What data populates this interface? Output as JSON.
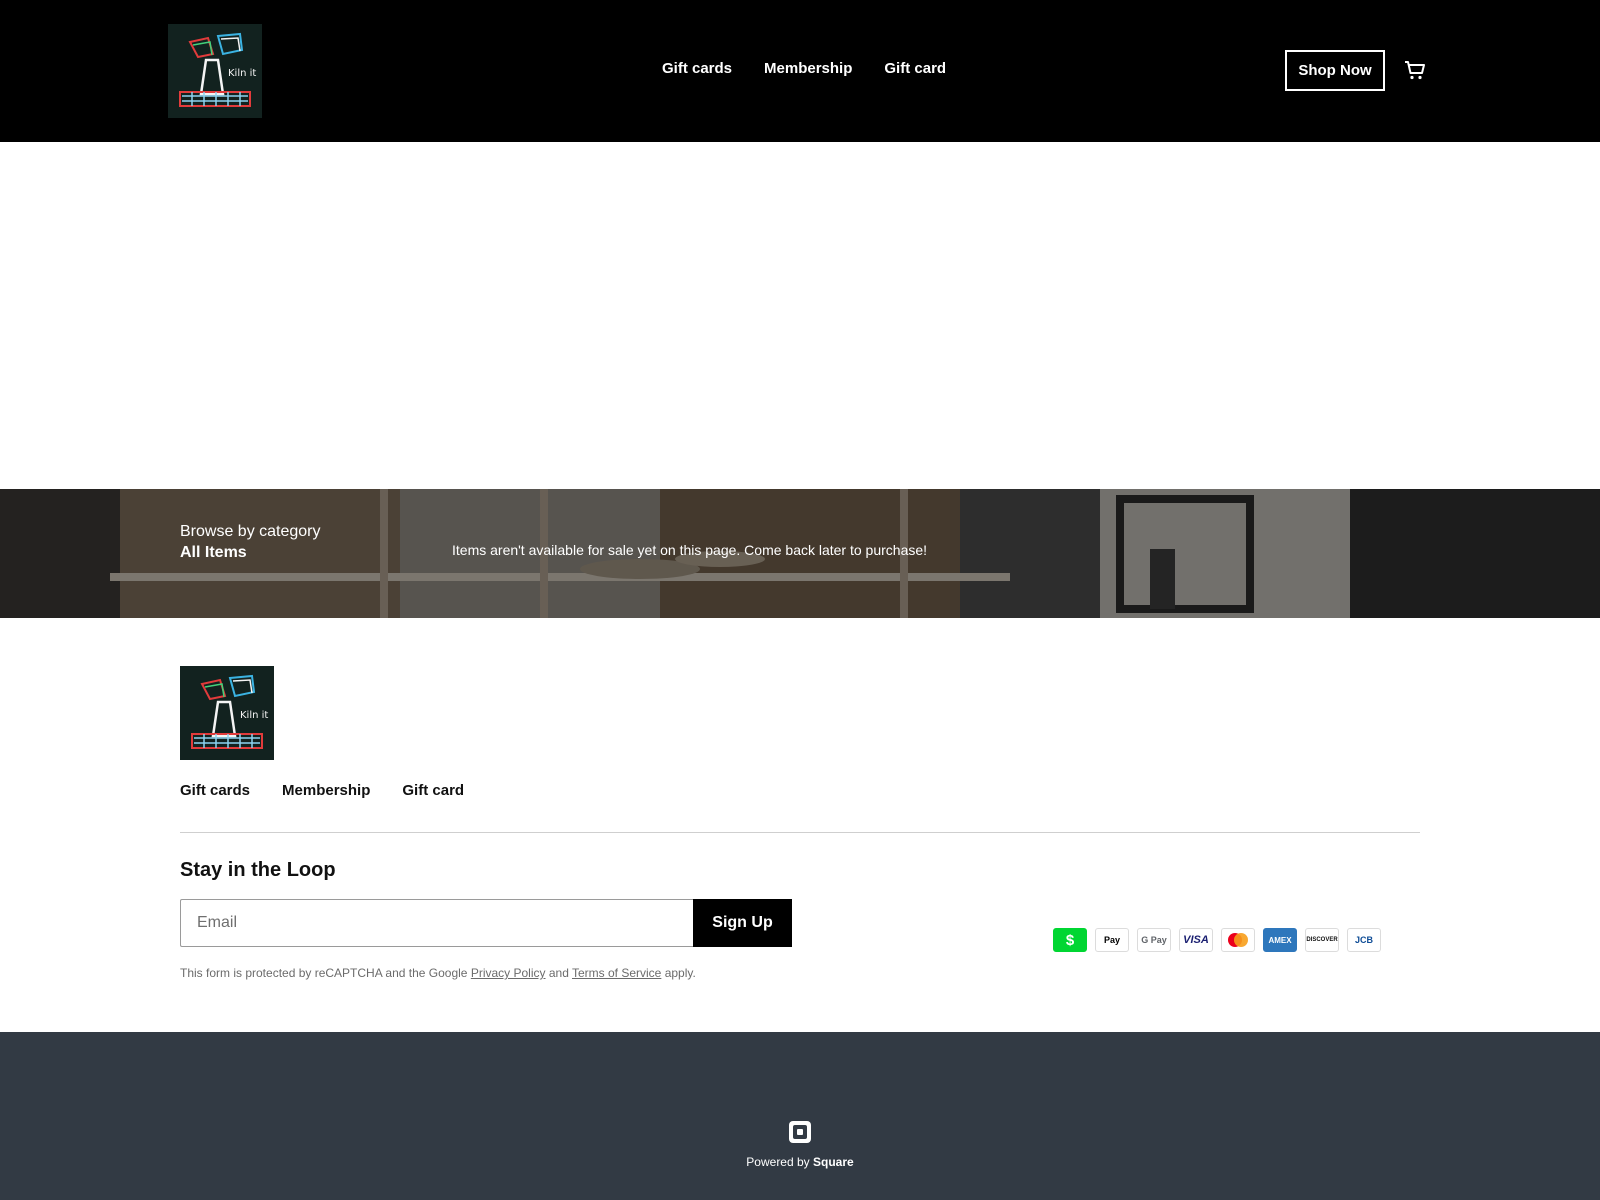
{
  "header": {
    "logo_text": "Kiln it",
    "nav": [
      "Gift cards",
      "Membership",
      "Gift card"
    ],
    "shop_button": "Shop Now",
    "cart_icon": "cart-icon"
  },
  "banner": {
    "browse_label": "Browse by category",
    "category": "All Items",
    "notice": "Items aren't available for sale yet on this page. Come back later to purchase!"
  },
  "footer": {
    "nav": [
      "Gift cards",
      "Membership",
      "Gift card"
    ],
    "newsletter": {
      "title": "Stay in the Loop",
      "email_placeholder": "Email",
      "signup_label": "Sign Up"
    },
    "recaptcha": {
      "prefix": "This form is protected by reCAPTCHA and the Google",
      "privacy": "Privacy Policy",
      "and": "and",
      "terms": "Terms of Service",
      "suffix": "apply."
    },
    "payment_methods": [
      "$",
      "Pay",
      "G Pay",
      "VISA",
      "",
      "AMEX",
      "DISCOVER",
      "JCB"
    ]
  },
  "bottom": {
    "powered_by": "Powered by",
    "brand": "Square"
  },
  "colors": {
    "header_bg": "#000000",
    "bottom_bg": "#323a44",
    "cash_app_green": "#00d632",
    "amex_blue": "#2e77bc"
  }
}
